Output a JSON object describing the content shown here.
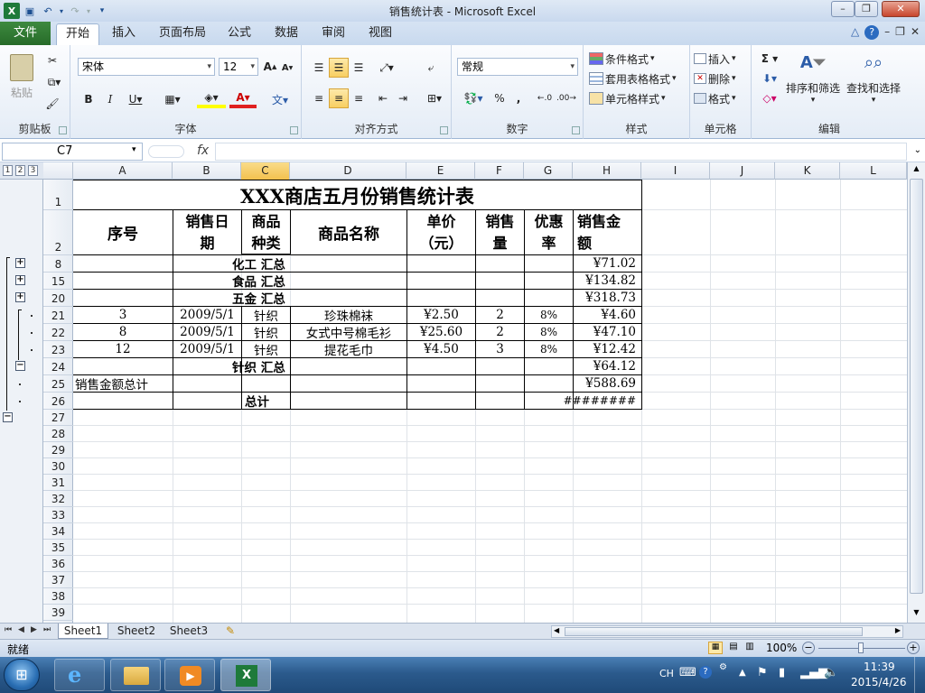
{
  "window": {
    "title": "销售统计表 - Microsoft Excel"
  },
  "tabs": {
    "file": "文件",
    "items": [
      "开始",
      "插入",
      "页面布局",
      "公式",
      "数据",
      "审阅",
      "视图"
    ]
  },
  "ribbon": {
    "clipboard": {
      "label": "剪贴板",
      "paste": "粘贴"
    },
    "font": {
      "label": "字体",
      "name": "宋体",
      "size": "12"
    },
    "alignment": {
      "label": "对齐方式"
    },
    "number": {
      "label": "数字",
      "format": "常规",
      "percent": "%"
    },
    "styles": {
      "label": "样式",
      "conditional": "条件格式",
      "table": "套用表格格式",
      "cell": "单元格样式"
    },
    "cells": {
      "label": "单元格",
      "insert": "插入",
      "delete": "删除",
      "format": "格式"
    },
    "editing": {
      "label": "编辑",
      "sort": "排序和筛选",
      "find": "查找和选择"
    }
  },
  "formula_bar": {
    "name_box": "C7",
    "fx": "fx"
  },
  "outline": {
    "levels": [
      "1",
      "2",
      "3"
    ]
  },
  "columns": [
    "A",
    "B",
    "C",
    "D",
    "E",
    "F",
    "G",
    "H",
    "I",
    "J",
    "K",
    "L"
  ],
  "rows": [
    "1",
    "2",
    "8",
    "15",
    "20",
    "21",
    "22",
    "23",
    "24",
    "25",
    "26",
    "27",
    "28",
    "29",
    "30",
    "31",
    "32",
    "33",
    "34",
    "35",
    "36",
    "37",
    "38",
    "39"
  ],
  "sheet": {
    "title": "XXX商店五月份销售统计表",
    "headers": [
      "序号",
      "销售日期",
      "商品种类",
      "商品名称",
      "单价（元）",
      "销售量",
      "优惠率",
      "销售金额"
    ],
    "header_lines": {
      "b": [
        "销售日",
        "期"
      ],
      "c": [
        "商品",
        "种类"
      ],
      "e": [
        "单价",
        "（元）"
      ],
      "f": [
        "销售",
        "量"
      ],
      "g": [
        "优惠",
        "率"
      ],
      "h": [
        "销售金",
        "额"
      ]
    },
    "subtotals": [
      {
        "row": "8",
        "label": "化工 汇总",
        "amount": "¥71.02"
      },
      {
        "row": "15",
        "label": "食品 汇总",
        "amount": "¥134.82"
      },
      {
        "row": "20",
        "label": "五金 汇总",
        "amount": "¥318.73"
      }
    ],
    "items": [
      {
        "row": "21",
        "no": "3",
        "date": "2009/5/1",
        "kind": "针织",
        "name": "珍珠棉袜",
        "price": "¥2.50",
        "qty": "2",
        "disc": "8%",
        "amount": "¥4.60"
      },
      {
        "row": "22",
        "no": "8",
        "date": "2009/5/1",
        "kind": "针织",
        "name": "女式中号棉毛衫",
        "price": "¥25.60",
        "qty": "2",
        "disc": "8%",
        "amount": "¥47.10"
      },
      {
        "row": "23",
        "no": "12",
        "date": "2009/5/1",
        "kind": "针织",
        "name": "提花毛巾",
        "price": "¥4.50",
        "qty": "3",
        "disc": "8%",
        "amount": "¥12.42"
      }
    ],
    "knit_total": {
      "label": "针织 汇总",
      "amount": "¥64.12"
    },
    "grand": {
      "label": "销售金额总计",
      "amount": "¥588.69"
    },
    "total": {
      "label": "总计",
      "amount": "########"
    }
  },
  "sheet_tabs": [
    "Sheet1",
    "Sheet2",
    "Sheet3"
  ],
  "status": {
    "ready": "就绪",
    "zoom": "100%"
  },
  "taskbar": {
    "lang": "CH",
    "time": "11:39",
    "date": "2015/4/26"
  }
}
